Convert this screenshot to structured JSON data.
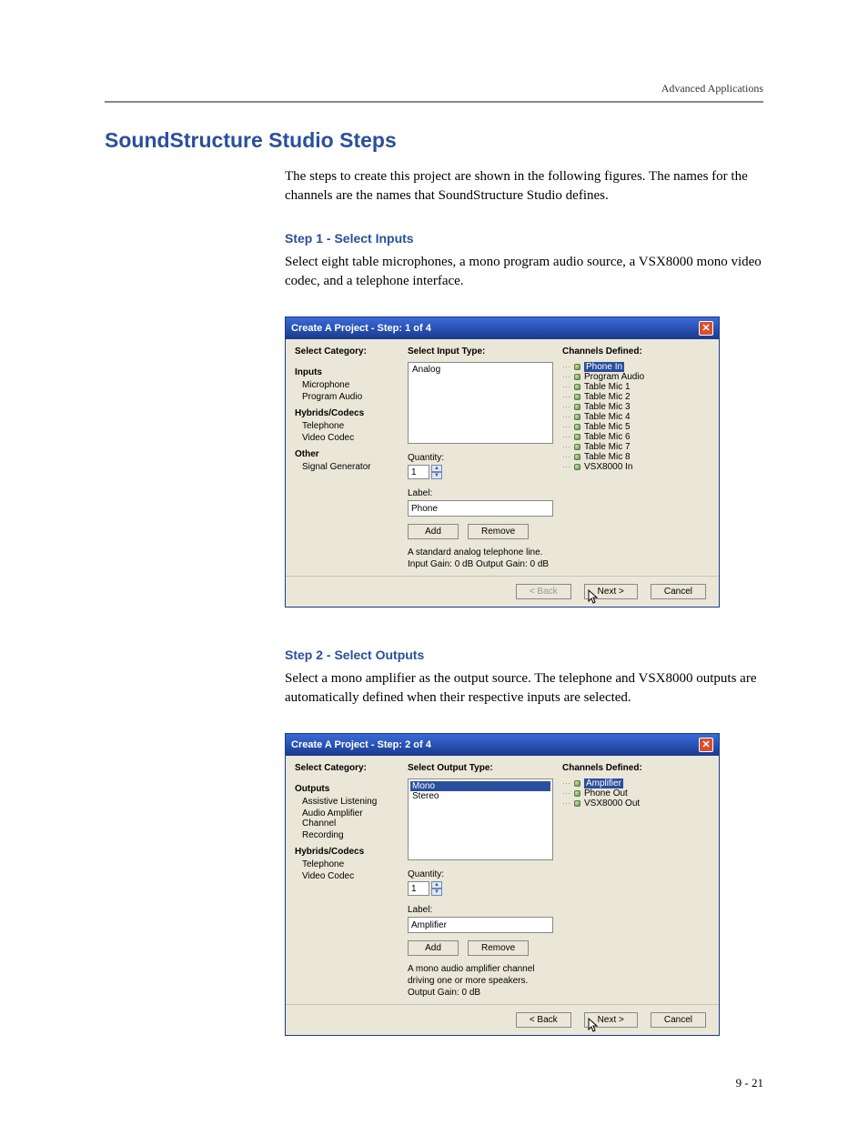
{
  "header": {
    "section": "Advanced Applications"
  },
  "main_heading": "SoundStructure Studio Steps",
  "intro": "The steps to create this project are shown in the following figures. The names for the channels are the names that SoundStructure Studio defines.",
  "step1": {
    "heading": "Step 1 - Select Inputs",
    "text": "Select eight table microphones, a mono program audio source, a VSX8000 mono video codec, and a telephone interface.",
    "dialog": {
      "title": "Create A Project - Step: 1 of 4",
      "labels": {
        "category": "Select Category:",
        "type": "Select Input Type:",
        "defined": "Channels Defined:",
        "quantity": "Quantity:",
        "label": "Label:"
      },
      "categories": {
        "group1": "Inputs",
        "items1": [
          "Microphone",
          "Program Audio"
        ],
        "group2": "Hybrids/Codecs",
        "items2": [
          "Telephone",
          "Video Codec"
        ],
        "group3": "Other",
        "items3": [
          "Signal Generator"
        ]
      },
      "type_list": [
        "Analog"
      ],
      "quantity": "1",
      "label_value": "Phone",
      "buttons": {
        "add": "Add",
        "remove": "Remove"
      },
      "description": "A standard analog telephone line.\nInput Gain: 0 dB   Output Gain: 0 dB",
      "channels": [
        "Phone In",
        "Program Audio",
        "Table Mic 1",
        "Table Mic 2",
        "Table Mic 3",
        "Table Mic 4",
        "Table Mic 5",
        "Table Mic 6",
        "Table Mic 7",
        "Table Mic 8",
        "VSX8000 In"
      ],
      "footer": {
        "back": "< Back",
        "next": "Next >",
        "cancel": "Cancel"
      }
    }
  },
  "step2": {
    "heading": "Step 2 - Select Outputs",
    "text": "Select a mono amplifier as the output source. The telephone and VSX8000 outputs are automatically defined when their respective inputs are selected.",
    "dialog": {
      "title": "Create A Project - Step: 2 of 4",
      "labels": {
        "category": "Select Category:",
        "type": "Select Output Type:",
        "defined": "Channels Defined:",
        "quantity": "Quantity:",
        "label": "Label:"
      },
      "categories": {
        "group1": "Outputs",
        "items1": [
          "Assistive Listening",
          "Audio Amplifier Channel",
          "Recording"
        ],
        "group2": "Hybrids/Codecs",
        "items2": [
          "Telephone",
          "Video Codec"
        ]
      },
      "type_list": [
        "Mono",
        "Stereo"
      ],
      "quantity": "1",
      "label_value": "Amplifier",
      "buttons": {
        "add": "Add",
        "remove": "Remove"
      },
      "description": "A mono audio amplifier channel driving one or more speakers.\nOutput Gain: 0 dB",
      "channels": [
        "Amplifier",
        "Phone Out",
        "VSX8000 Out"
      ],
      "footer": {
        "back": "< Back",
        "next": "Next >",
        "cancel": "Cancel"
      }
    }
  },
  "page_number": "9 - 21"
}
